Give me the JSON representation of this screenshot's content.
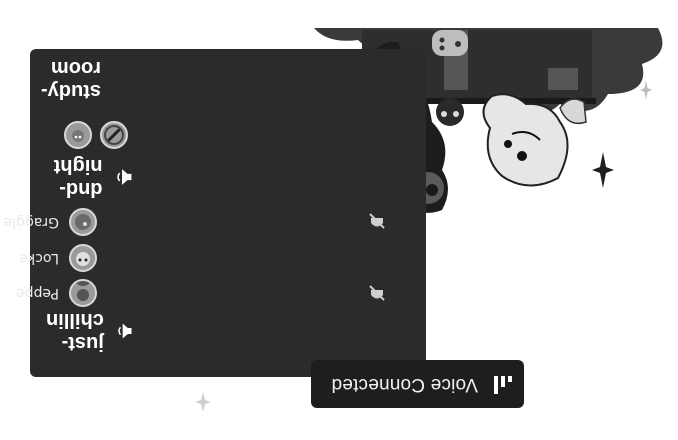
{
  "voice_bar": {
    "status": "Voice Connected",
    "icon": "signal-bars-icon"
  },
  "channels": [
    {
      "name": "just-chillin",
      "icon": "speaker-icon",
      "members": [
        {
          "name": "Peppe",
          "muted": true
        },
        {
          "name": "Locke",
          "muted": false
        },
        {
          "name": "Graggle",
          "muted": true
        }
      ]
    },
    {
      "name": "dnd-night",
      "icon": "speaker-icon",
      "avatars": 2
    },
    {
      "name": "study-room",
      "icon": "speaker-icon"
    }
  ],
  "colors": {
    "panel": "#2b2b2b",
    "voice_bar": "#1e1e1e",
    "text": "#ffffff",
    "background": "#ffffff"
  }
}
